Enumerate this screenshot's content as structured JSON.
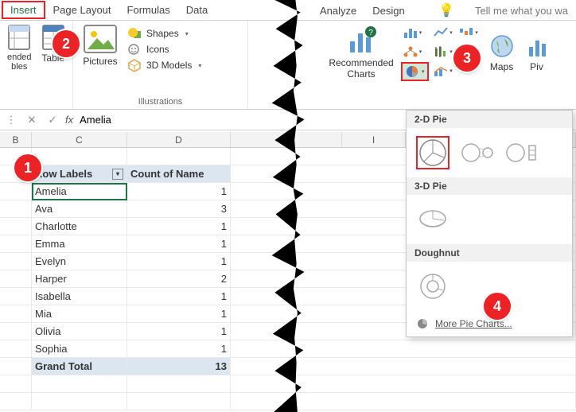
{
  "tabs": {
    "insert": "Insert",
    "page_layout": "Page Layout",
    "formulas": "Formulas",
    "data": "Data",
    "analyze": "Analyze",
    "design": "Design",
    "tell_me": "Tell me what you wa"
  },
  "ribbon": {
    "tables": {
      "label": "",
      "recommended": "ended\nbles",
      "table": "Table"
    },
    "illustrations": {
      "label": "Illustrations",
      "pictures": "Pictures",
      "shapes": "Shapes",
      "icons": "Icons",
      "models": "3D Models"
    },
    "charts": {
      "recommended": "Recommended\nCharts",
      "maps": "Maps",
      "pivot": "Piv"
    }
  },
  "formula_bar": {
    "fx": "fx",
    "value": "Amelia"
  },
  "columns": {
    "b": "B",
    "c": "C",
    "d": "D",
    "i": "I"
  },
  "pivot": {
    "row_labels": "Row Labels",
    "count_header": "Count of Name",
    "grand_total": "Grand Total",
    "grand_total_value": "13",
    "rows": [
      {
        "name": "Amelia",
        "count": "1"
      },
      {
        "name": "Ava",
        "count": "3"
      },
      {
        "name": "Charlotte",
        "count": "1"
      },
      {
        "name": "Emma",
        "count": "1"
      },
      {
        "name": "Evelyn",
        "count": "1"
      },
      {
        "name": "Harper",
        "count": "2"
      },
      {
        "name": "Isabella",
        "count": "1"
      },
      {
        "name": "Mia",
        "count": "1"
      },
      {
        "name": "Olivia",
        "count": "1"
      },
      {
        "name": "Sophia",
        "count": "1"
      }
    ]
  },
  "pie_dropdown": {
    "section_2d": "2-D Pie",
    "section_3d": "3-D Pie",
    "section_doughnut": "Doughnut",
    "more": "More Pie Charts..."
  },
  "badges": {
    "b1": "1",
    "b2": "2",
    "b3": "3",
    "b4": "4"
  }
}
